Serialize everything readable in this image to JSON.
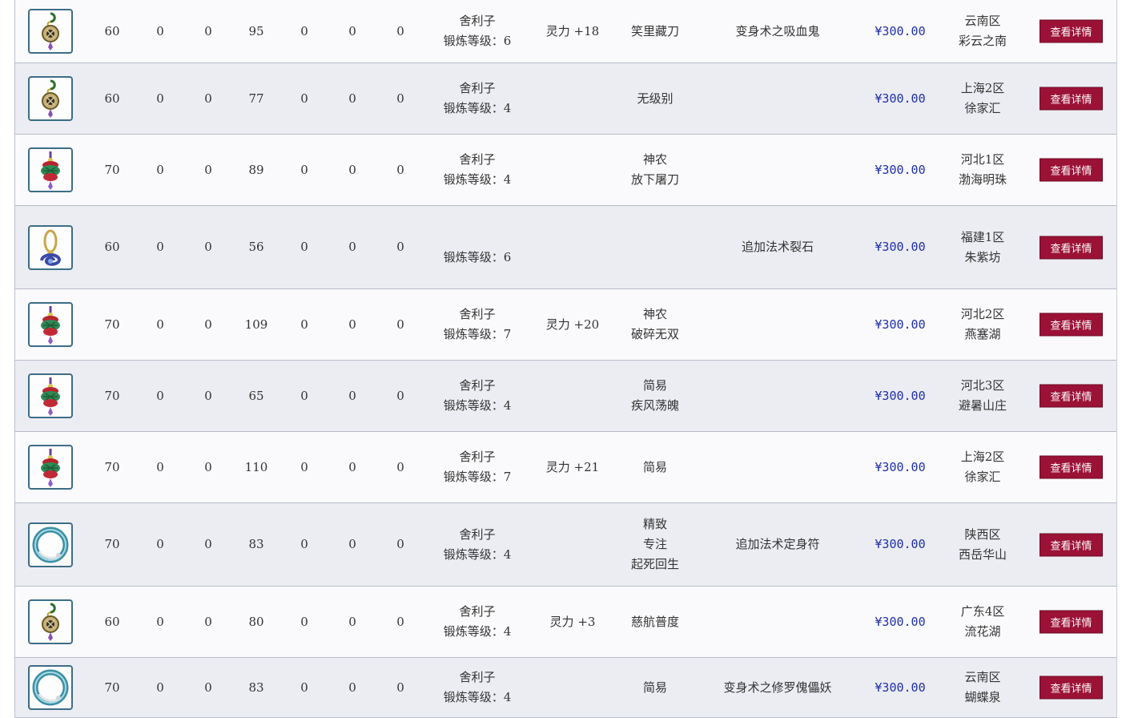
{
  "currency_symbol": "¥",
  "rows": [
    {
      "icon": "cloud-pendant-icon",
      "level": "60",
      "a": "0",
      "b": "0",
      "c": "95",
      "d": "0",
      "e": "0",
      "f": "0",
      "gem": "舍利子",
      "forge": "锻炼等级：6",
      "bonus": "灵力 +18",
      "traits": [
        "笑里藏刀"
      ],
      "effect": "变身术之吸血鬼",
      "price": "¥300.00",
      "server": [
        "云南区",
        "彩云之南"
      ],
      "button": "查看详情"
    },
    {
      "icon": "cloud-pendant-icon",
      "level": "60",
      "a": "0",
      "b": "0",
      "c": "77",
      "d": "0",
      "e": "0",
      "f": "0",
      "gem": "舍利子",
      "forge": "锻炼等级：4",
      "bonus": "",
      "traits": [
        "无级别"
      ],
      "effect": "",
      "price": "¥300.00",
      "server": [
        "上海2区",
        "徐家汇"
      ],
      "button": "查看详情"
    },
    {
      "icon": "flower-pendant-icon",
      "level": "70",
      "a": "0",
      "b": "0",
      "c": "89",
      "d": "0",
      "e": "0",
      "f": "0",
      "gem": "舍利子",
      "forge": "锻炼等级：4",
      "bonus": "",
      "traits": [
        "神农",
        "放下屠刀"
      ],
      "effect": "",
      "price": "¥300.00",
      "server": [
        "河北1区",
        "渤海明珠"
      ],
      "button": "查看详情"
    },
    {
      "icon": "swirl-pendant-icon",
      "level": "60",
      "a": "0",
      "b": "0",
      "c": "56",
      "d": "0",
      "e": "0",
      "f": "0",
      "gem": "",
      "forge": "锻炼等级：6",
      "bonus": "",
      "traits": [],
      "effect": "追加法术裂石",
      "price": "¥300.00",
      "server": [
        "福建1区",
        "朱紫坊"
      ],
      "button": "查看详情"
    },
    {
      "icon": "flower-pendant-icon",
      "level": "70",
      "a": "0",
      "b": "0",
      "c": "109",
      "d": "0",
      "e": "0",
      "f": "0",
      "gem": "舍利子",
      "forge": "锻炼等级：7",
      "bonus": "灵力 +20",
      "traits": [
        "神农",
        "破碎无双"
      ],
      "effect": "",
      "price": "¥300.00",
      "server": [
        "河北2区",
        "燕塞湖"
      ],
      "button": "查看详情"
    },
    {
      "icon": "flower-pendant-icon",
      "level": "70",
      "a": "0",
      "b": "0",
      "c": "65",
      "d": "0",
      "e": "0",
      "f": "0",
      "gem": "舍利子",
      "forge": "锻炼等级：4",
      "bonus": "",
      "traits": [
        "简易",
        "疾风荡魄"
      ],
      "effect": "",
      "price": "¥300.00",
      "server": [
        "河北3区",
        "避暑山庄"
      ],
      "button": "查看详情"
    },
    {
      "icon": "flower-pendant-icon",
      "level": "70",
      "a": "0",
      "b": "0",
      "c": "110",
      "d": "0",
      "e": "0",
      "f": "0",
      "gem": "舍利子",
      "forge": "锻炼等级：7",
      "bonus": "灵力 +21",
      "traits": [
        "简易"
      ],
      "effect": "",
      "price": "¥300.00",
      "server": [
        "上海2区",
        "徐家汇"
      ],
      "button": "查看详情"
    },
    {
      "icon": "jade-ring-icon",
      "level": "70",
      "a": "0",
      "b": "0",
      "c": "83",
      "d": "0",
      "e": "0",
      "f": "0",
      "gem": "舍利子",
      "forge": "锻炼等级：4",
      "bonus": "",
      "traits": [
        "精致",
        "专注",
        "起死回生"
      ],
      "effect": "追加法术定身符",
      "price": "¥300.00",
      "server": [
        "陕西区",
        "西岳华山"
      ],
      "button": "查看详情"
    },
    {
      "icon": "cloud-pendant-icon",
      "level": "60",
      "a": "0",
      "b": "0",
      "c": "80",
      "d": "0",
      "e": "0",
      "f": "0",
      "gem": "舍利子",
      "forge": "锻炼等级：4",
      "bonus": "灵力 +3",
      "traits": [
        "慈航普度"
      ],
      "effect": "",
      "price": "¥300.00",
      "server": [
        "广东4区",
        "流花湖"
      ],
      "button": "查看详情"
    },
    {
      "icon": "jade-ring-icon",
      "level": "70",
      "a": "0",
      "b": "0",
      "c": "83",
      "d": "0",
      "e": "0",
      "f": "0",
      "gem": "舍利子",
      "forge": "锻炼等级：4",
      "bonus": "",
      "traits": [
        "简易"
      ],
      "effect": "变身术之修罗傀儡妖",
      "price": "¥300.00",
      "server": [
        "云南区",
        "蝴蝶泉"
      ],
      "button": "查看详情"
    }
  ]
}
